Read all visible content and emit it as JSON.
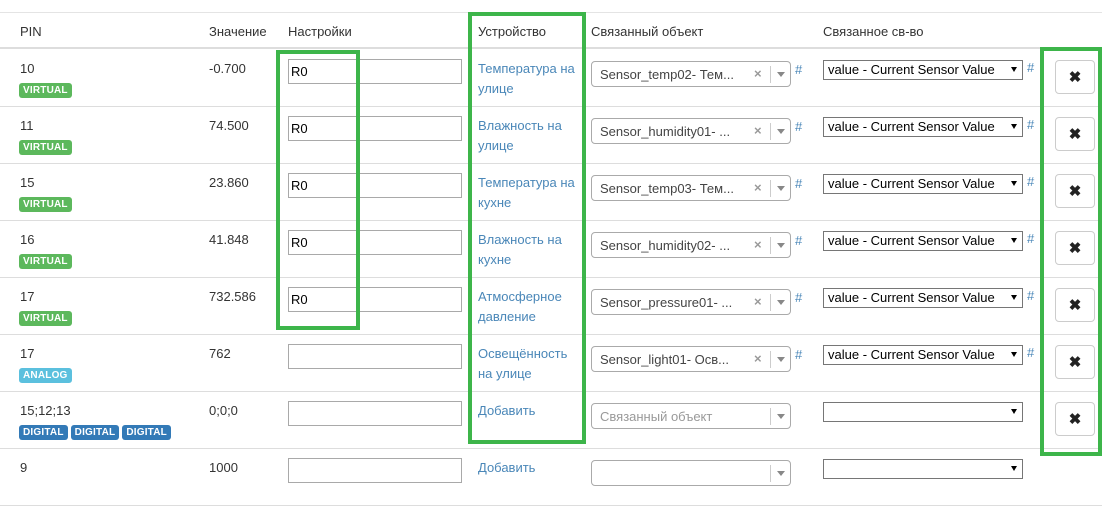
{
  "headers": {
    "pin": "PIN",
    "value": "Значение",
    "settings": "Настройки",
    "device": "Устройство",
    "linked_object": "Связанный объект",
    "linked_property": "Связанное св-во"
  },
  "rows": [
    {
      "pin": "10",
      "badges": [
        {
          "label": "VIRTUAL",
          "type": "virtual"
        }
      ],
      "value": "-0.700",
      "setting": "R0",
      "device": "Температура на улице",
      "linked_object": "Sensor_temp02- Тем...",
      "linked_property": "value - Current Sensor Value"
    },
    {
      "pin": "11",
      "badges": [
        {
          "label": "VIRTUAL",
          "type": "virtual"
        }
      ],
      "value": "74.500",
      "setting": "R0",
      "device": "Влажность на улице",
      "linked_object": "Sensor_humidity01- ...",
      "linked_property": "value - Current Sensor Value"
    },
    {
      "pin": "15",
      "badges": [
        {
          "label": "VIRTUAL",
          "type": "virtual"
        }
      ],
      "value": "23.860",
      "setting": "R0",
      "device": "Температура на кухне",
      "linked_object": "Sensor_temp03- Тем...",
      "linked_property": "value - Current Sensor Value"
    },
    {
      "pin": "16",
      "badges": [
        {
          "label": "VIRTUAL",
          "type": "virtual"
        }
      ],
      "value": "41.848",
      "setting": "R0",
      "device": "Влажность на кухне",
      "linked_object": "Sensor_humidity02- ...",
      "linked_property": "value - Current Sensor Value"
    },
    {
      "pin": "17",
      "badges": [
        {
          "label": "VIRTUAL",
          "type": "virtual"
        }
      ],
      "value": "732.586",
      "setting": "R0",
      "device": "Атмосферное давление",
      "linked_object": "Sensor_pressure01- ...",
      "linked_property": "value - Current Sensor Value"
    },
    {
      "pin": "17",
      "badges": [
        {
          "label": "ANALOG",
          "type": "analog"
        }
      ],
      "value": "762",
      "setting": "",
      "device": "Освещённость на улице",
      "linked_object": "Sensor_light01- Осв...",
      "linked_property": "value - Current Sensor Value"
    },
    {
      "pin": "15;12;13",
      "badges": [
        {
          "label": "DIGITAL",
          "type": "digital"
        },
        {
          "label": "DIGITAL",
          "type": "digital"
        },
        {
          "label": "DIGITAL",
          "type": "digital"
        }
      ],
      "value": "0;0;0",
      "setting": "",
      "device": "Добавить",
      "linked_object": "",
      "linked_object_placeholder": "Связанный объект",
      "linked_property": ""
    },
    {
      "pin": "9",
      "badges": [],
      "value": "1000",
      "setting": "",
      "device": "Добавить",
      "linked_object": "",
      "linked_object_placeholder": "",
      "linked_property": ""
    }
  ],
  "hash_link": "#",
  "delete_icon": "×-icon",
  "colors": {
    "highlight": "#3db54a",
    "link": "#4a87b8",
    "virtual": "#5cb85c",
    "analog": "#5bc0de",
    "digital": "#337ab7"
  }
}
